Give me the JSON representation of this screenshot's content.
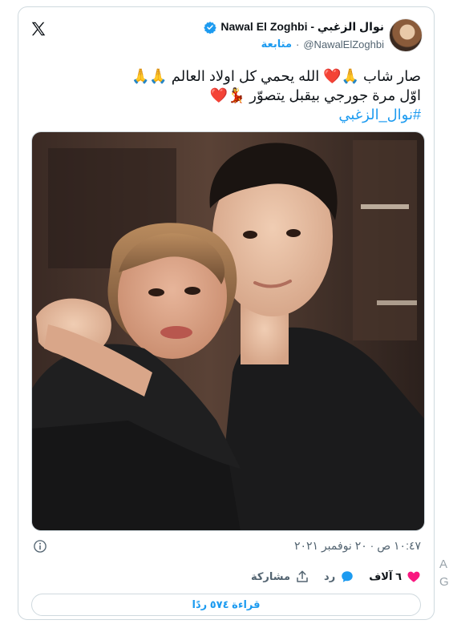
{
  "tweet": {
    "author": {
      "display_name": "Nawal El Zoghbi - نوال الزغبي",
      "handle": "@NawalElZoghbi",
      "follow_label": "متابعة",
      "separator": "·"
    },
    "text_lines": [
      "صار شاب 🙏❤️ الله يحمي كل اولاد العالم 🙏🙏",
      "اوّل مرة جورجي بيقبل يتصوّر 💃❤️"
    ],
    "hashtag": "#نوال_الزغبي",
    "timestamp": "١٠:٤٧ ص · ٢٠ نوفمبر ٢٠٢١",
    "actions": {
      "like_count": "٦ آلاف",
      "reply_label": "رد",
      "share_label": "مشاركة"
    },
    "read_replies_label": "قراءة ٥٧٤ ردًا"
  },
  "edge_text": [
    "A",
    "G"
  ],
  "icons": {
    "logo": "x-logo-icon",
    "verified": "verified-badge-icon",
    "info": "info-icon",
    "like": "heart-icon",
    "reply": "reply-bubble-icon",
    "share": "share-upload-icon"
  },
  "colors": {
    "accent": "#1d9bf0",
    "like": "#f91880",
    "text": "#0f1419",
    "muted": "#536471",
    "border": "#cfd9de"
  }
}
